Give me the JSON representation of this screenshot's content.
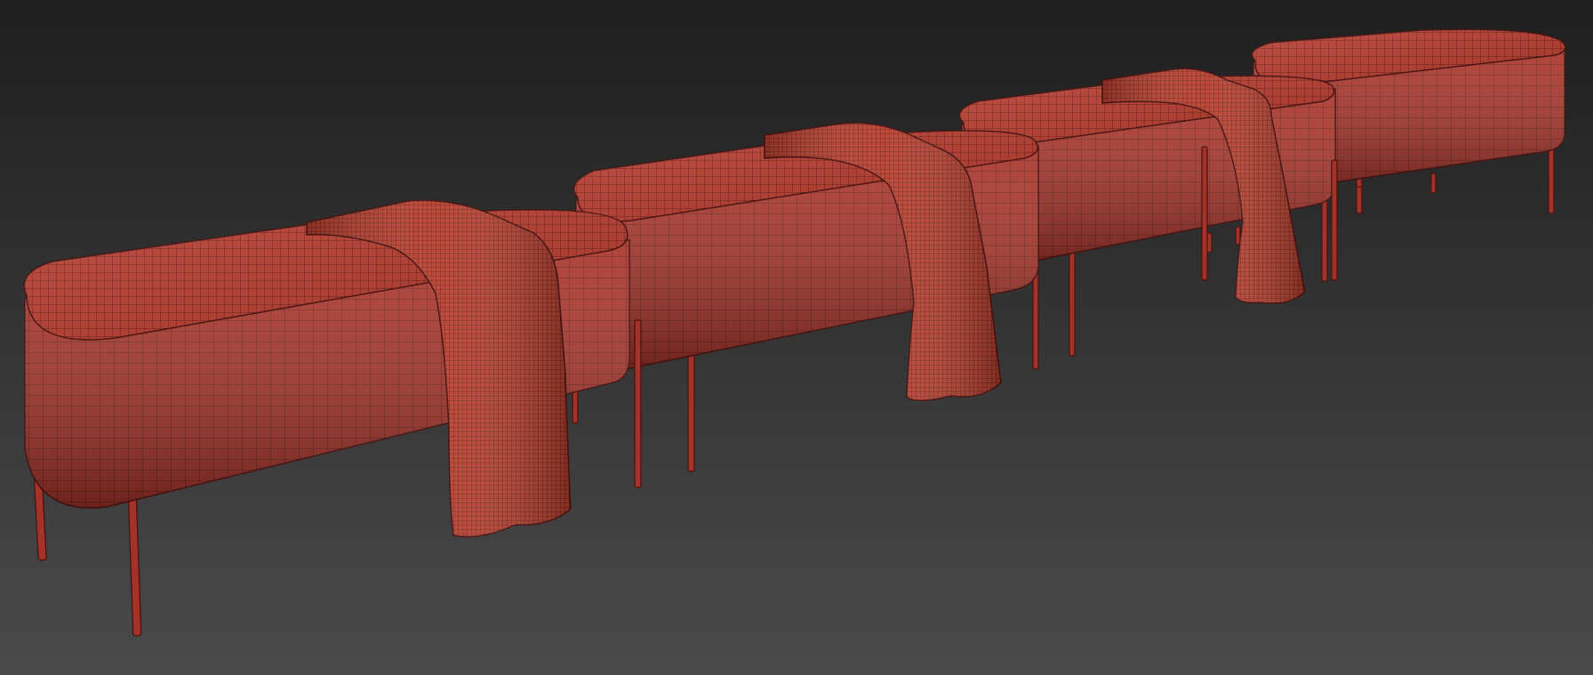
{
  "scene": {
    "description_visible_text": "",
    "background_top": "#1f1f1f",
    "background_bottom": "#4a4a4a",
    "wire_color": "#4a1210",
    "surface_color": "#b8392c",
    "surface_light": "#d4503f",
    "surface_dark": "#7c2018",
    "leg_color": "#a33328"
  },
  "objects": [
    {
      "name": "bench-1",
      "kind": "upholstered bench with metal legs",
      "has_throw": true
    },
    {
      "name": "bench-2",
      "kind": "upholstered bench with metal legs",
      "has_throw": true
    },
    {
      "name": "bench-3",
      "kind": "upholstered bench with metal legs",
      "has_throw": true
    },
    {
      "name": "bench-4",
      "kind": "upholstered bench with metal legs",
      "has_throw": false
    }
  ]
}
